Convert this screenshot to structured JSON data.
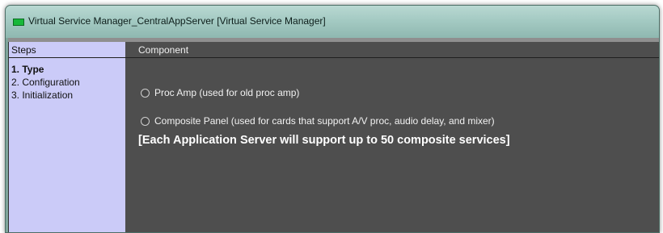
{
  "window": {
    "title": "Virtual Service Manager_CentralAppServer [Virtual Service Manager]",
    "icon": "app-window-icon"
  },
  "steps": {
    "header": "Steps",
    "items": [
      {
        "label": "1. Type",
        "active": true
      },
      {
        "label": "2. Configuration",
        "active": false
      },
      {
        "label": "3. Initialization",
        "active": false
      }
    ]
  },
  "component": {
    "header": "Component",
    "options": [
      {
        "label": "Proc Amp (used for old proc amp)",
        "selected": false
      },
      {
        "label": "Composite Panel (used for cards that support A/V proc, audio delay, and mixer)",
        "selected": false
      }
    ],
    "notice": "[Each Application Server will support up to 50 composite services]"
  },
  "colors": {
    "steps_background": "#cbcbf8",
    "content_background": "#4e4e4e",
    "titlebar": "#a4cac3"
  }
}
